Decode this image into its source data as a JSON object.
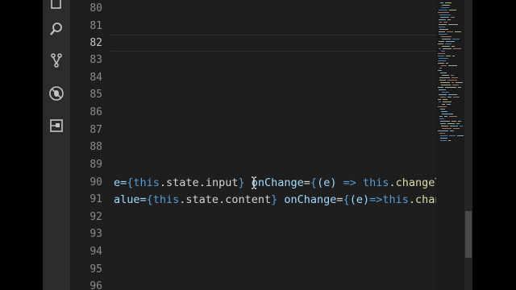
{
  "editor": {
    "line_numbers": [
      "80",
      "81",
      "82",
      "83",
      "84",
      "85",
      "86",
      "87",
      "88",
      "89",
      "90",
      "91",
      "92",
      "93",
      "94",
      "95",
      "96"
    ],
    "active_line": "82",
    "line90_tokens": [
      {
        "t": "e=",
        "c": "t-attr"
      },
      {
        "t": "{",
        "c": "t-brace"
      },
      {
        "t": "this",
        "c": "t-kw"
      },
      {
        "t": ".state.input",
        "c": "t-prop"
      },
      {
        "t": "}",
        "c": "t-brace"
      },
      {
        "t": " ",
        "c": "t-punc"
      },
      {
        "t": "onChange",
        "c": "t-attr"
      },
      {
        "t": "=",
        "c": "t-punc"
      },
      {
        "t": "{",
        "c": "t-brace"
      },
      {
        "t": "(e) ",
        "c": "t-par"
      },
      {
        "t": "=>",
        "c": "t-kw"
      },
      {
        "t": " ",
        "c": "t-punc"
      },
      {
        "t": "this",
        "c": "t-kw"
      },
      {
        "t": ".changeTitle(e",
        "c": "t-fn"
      }
    ],
    "line91_tokens": [
      {
        "t": "alue=",
        "c": "t-attr"
      },
      {
        "t": "{",
        "c": "t-brace"
      },
      {
        "t": "this",
        "c": "t-kw"
      },
      {
        "t": ".state.content",
        "c": "t-prop"
      },
      {
        "t": "}",
        "c": "t-brace"
      },
      {
        "t": " ",
        "c": "t-punc"
      },
      {
        "t": "onChange",
        "c": "t-attr"
      },
      {
        "t": "=",
        "c": "t-punc"
      },
      {
        "t": "{",
        "c": "t-brace"
      },
      {
        "t": "(e)",
        "c": "t-par"
      },
      {
        "t": "=>",
        "c": "t-kw"
      },
      {
        "t": "this",
        "c": "t-kw"
      },
      {
        "t": ".changeTitle",
        "c": "t-fn"
      }
    ]
  },
  "activity_bar": {
    "icons": [
      "explorer-icon",
      "search-icon",
      "source-control-icon",
      "debug-icon",
      "extensions-icon"
    ]
  },
  "colors": {
    "editor_bg": "#1e1e1e",
    "activity_bg": "#2c2c2c",
    "keyword": "#569cd6",
    "attribute": "#9cdcfe",
    "function": "#dcdcaa"
  }
}
